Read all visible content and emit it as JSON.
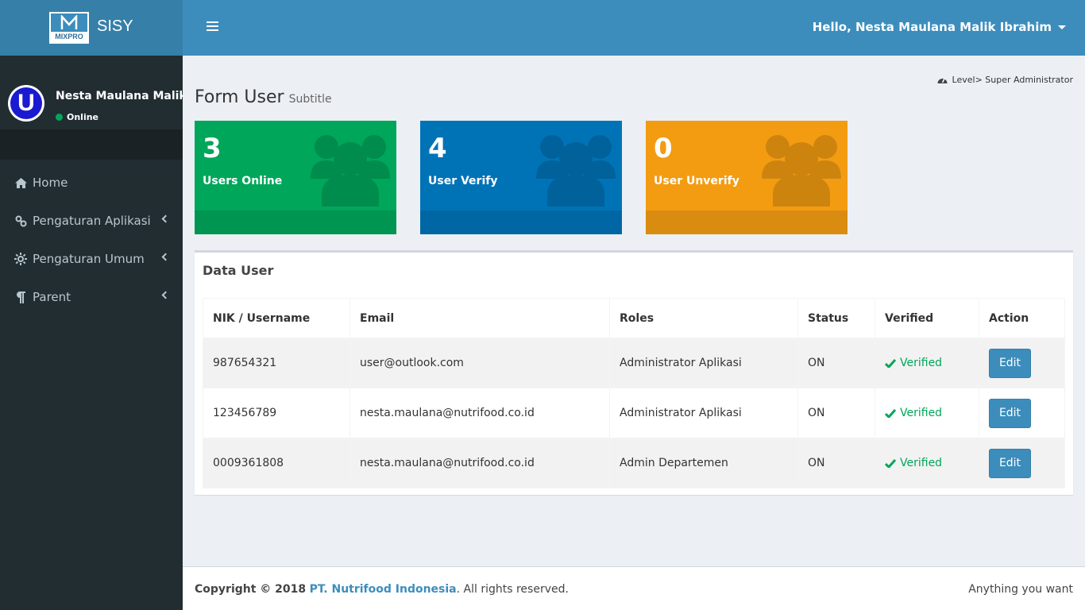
{
  "app": {
    "name": "SISY",
    "logo_text": "MIXPRO"
  },
  "header": {
    "greeting": "Hello, Nesta Maulana Malik Ibrahim"
  },
  "sidebar": {
    "user": {
      "avatar_letter": "U",
      "name": "Nesta Maulana Malik Ibrahim",
      "status": "Online"
    },
    "items": [
      {
        "label": "Home",
        "icon": "home-icon"
      },
      {
        "label": "Pengaturan Aplikasi",
        "icon": "link-icon"
      },
      {
        "label": "Pengaturan Umum",
        "icon": "settings-icon"
      },
      {
        "label": "Parent",
        "icon": "paragraph-icon"
      }
    ]
  },
  "page": {
    "level": "Level> Super Administrator",
    "title": "Form User",
    "subtitle": "Subtitle"
  },
  "stats": [
    {
      "value": "3",
      "label": "Users Online",
      "color": "#00a65a"
    },
    {
      "value": "4",
      "label": "User Verify",
      "color": "#0073b7"
    },
    {
      "value": "0",
      "label": "User Unverify",
      "color": "#f39c12"
    }
  ],
  "table": {
    "title": "Data User",
    "headers": [
      "NIK / Username",
      "Email",
      "Roles",
      "Status",
      "Verified",
      "Action"
    ],
    "rows": [
      {
        "nik": "987654321",
        "email": "user@outlook.com",
        "role": "Administrator Aplikasi",
        "status": "ON",
        "verified": "Verified",
        "action": "Edit"
      },
      {
        "nik": "123456789",
        "email": "nesta.maulana@nutrifood.co.id",
        "role": "Administrator Aplikasi",
        "status": "ON",
        "verified": "Verified",
        "action": "Edit"
      },
      {
        "nik": "0009361808",
        "email": "nesta.maulana@nutrifood.co.id",
        "role": "Admin Departemen",
        "status": "ON",
        "verified": "Verified",
        "action": "Edit"
      }
    ]
  },
  "footer": {
    "copyright_prefix": "Copyright © 2018",
    "company": "PT. Nutrifood Indonesia",
    "suffix": ". All rights reserved.",
    "tagline": "Anything you want"
  }
}
